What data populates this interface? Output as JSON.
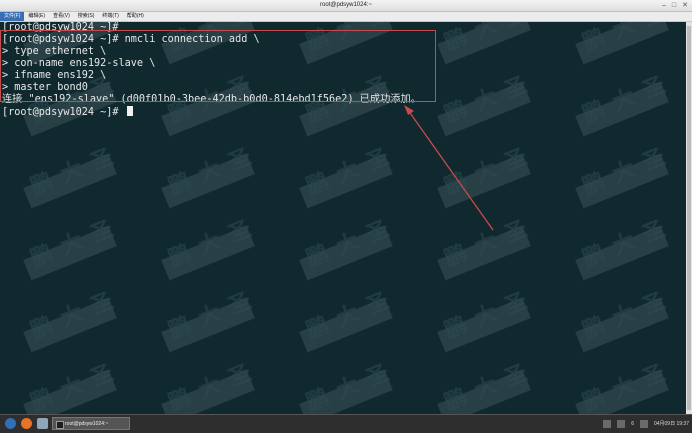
{
  "window": {
    "title": "root@pdsyw1024:~",
    "controls": [
      "–",
      "□",
      "✕"
    ]
  },
  "menu": [
    "文件(F)",
    "编辑(E)",
    "查看(V)",
    "搜索(S)",
    "终端(T)",
    "帮助(H)"
  ],
  "terminal": {
    "lines": [
      "[root@pdsyw1024 ~]#",
      "[root@pdsyw1024 ~]# nmcli connection add \\",
      "> type ethernet \\",
      "> con-name ens192-slave \\",
      "> ifname ens192 \\",
      "> master bond0",
      "连接 \"ens192-slave\" (d00f01b0-3bee-42db-b0d0-814ebd1f56e2) 已成功添加。",
      "[root@pdsyw1024 ~]# "
    ]
  },
  "watermark": {
    "chars": [
      "鹏",
      "大",
      "圣"
    ]
  },
  "taskbar": {
    "task_label": "root@pdsyw1024:~",
    "tray_num": "6",
    "clock": "04月09日 19:37"
  },
  "colors": {
    "annotation": "#c94a4a",
    "terminal_bg": "#10292f"
  }
}
